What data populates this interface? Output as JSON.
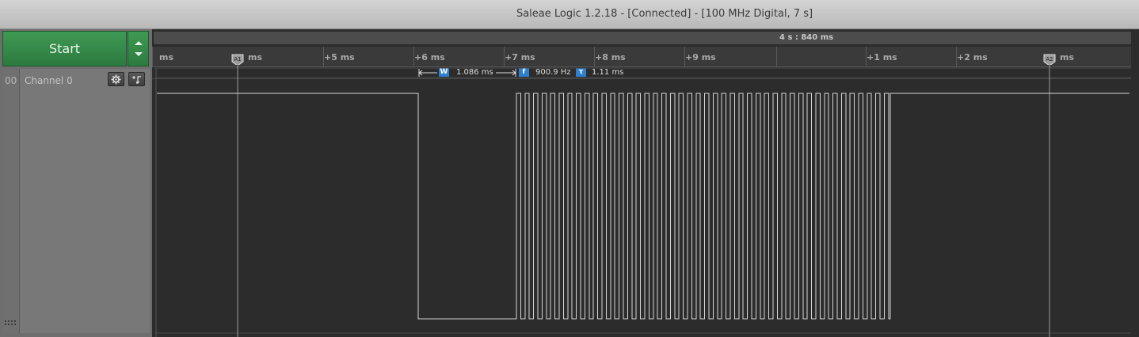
{
  "window": {
    "title": "Saleae Logic 1.2.18 - [Connected] - [100 MHz Digital, 7 s]"
  },
  "toolbar": {
    "start_label": "Start"
  },
  "channel": {
    "number": "00",
    "name": "Channel 0"
  },
  "overview": {
    "time_label": "4 s : 840 ms"
  },
  "ruler": {
    "ticks": [
      "ms",
      "ms",
      "+5 ms",
      "+6 ms",
      "+7 ms",
      "+8 ms",
      "+9 ms",
      "+1 ms",
      "+2 ms",
      "ms"
    ]
  },
  "markers": {
    "a1": "A1",
    "a2": "A2"
  },
  "measurements": {
    "width_badge": "W",
    "width_value": "1.086 ms",
    "freq_badge": "f",
    "freq_value": "900.9 Hz",
    "period_badge": "τ",
    "period_value": "1.11 ms"
  },
  "icons": {
    "start_options": "up-down-chevron-icon",
    "settings": "gear-icon",
    "trigger": "trigger-icon",
    "grip": "resize-grip-icon"
  },
  "colors": {
    "start_green": "#2f8a44",
    "signal": "#d6d6d6",
    "badge_blue": "#2f7fd0"
  }
}
